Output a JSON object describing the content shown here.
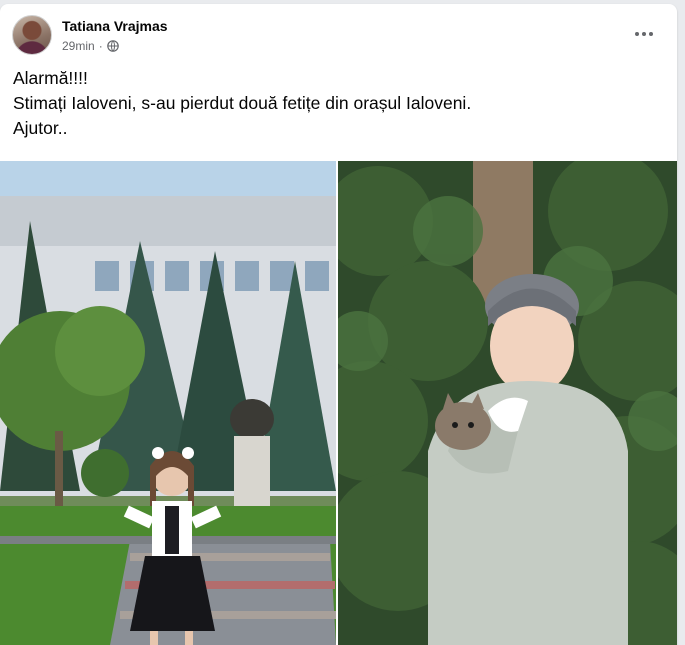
{
  "post": {
    "author": "Tatiana Vrajmas",
    "time": "29min",
    "separator": "·",
    "privacy_icon": "globe-icon",
    "more_icon": "more-options-icon",
    "lines": [
      "Alarmă!!!!",
      "Stimați Ialoveni, s-au pierdut două fetițe din orașul Ialoveni.",
      "Ajutor.."
    ]
  },
  "photos": [
    {
      "subject": "girl in school uniform in front of a building and monument"
    },
    {
      "subject": "girl in green jacket holding a kitten near evergreen shrubs"
    }
  ],
  "colors": {
    "name": "#050505",
    "meta": "#65676b",
    "background": "#e9ebee",
    "card": "#ffffff"
  }
}
